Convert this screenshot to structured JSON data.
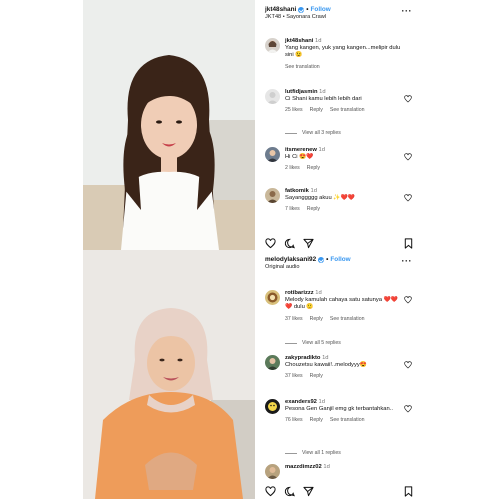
{
  "post1": {
    "username": "jkt48shani",
    "follow_label": "Follow",
    "subtitle": "JKT48 • Sayonara Crawl",
    "caption": {
      "username": "jkt48shani",
      "time": "1d",
      "text": "Yang kangen, yuk yang kangen...melipir dulu sini 😉",
      "translation": "See translation"
    },
    "comments": [
      {
        "username": "lutfidjasmin",
        "time": "1d",
        "text": "Ci Shani kamu lebih lebih dari",
        "likes": "25 likes",
        "reply": "Reply",
        "translation": "See translation",
        "view_replies": "View all 3 replies"
      },
      {
        "username": "itsmerenew",
        "time": "1d",
        "text": "Hi Ci 😍❤️",
        "likes": "2 likes",
        "reply": "Reply"
      },
      {
        "username": "fatkomik",
        "time": "1d",
        "text": "Sayanggggg akuu ✨❤️❤️",
        "likes": "7 likes",
        "reply": "Reply"
      }
    ]
  },
  "post2": {
    "username": "melodylaksani92",
    "follow_label": "Follow",
    "subtitle": "Original audio",
    "comments": [
      {
        "username": "rotibarizzz",
        "time": "1d",
        "text": "Melody kamulah cahaya satu satunya ❤️❤️❤️ dulu 🙂",
        "likes": "37 likes",
        "reply": "Reply",
        "translation": "See translation",
        "view_replies": "View all 5 replies"
      },
      {
        "username": "zakypradikto",
        "time": "1d",
        "text": "Chouzetsu kawaii!..melodyyy😍",
        "likes": "37 likes",
        "reply": "Reply"
      },
      {
        "username": "exanders92",
        "time": "1d",
        "text": "Pesona Gen Ganjil emg gk terbantahkan..",
        "likes": "76 likes",
        "reply": "Reply",
        "translation": "See translation",
        "view_replies": "View all 1 replies"
      },
      {
        "username": "mazzdimzz02",
        "time": "1d",
        "text": ""
      }
    ]
  },
  "colors": {
    "accent": "#3897f0",
    "heart": "#ed4956"
  }
}
